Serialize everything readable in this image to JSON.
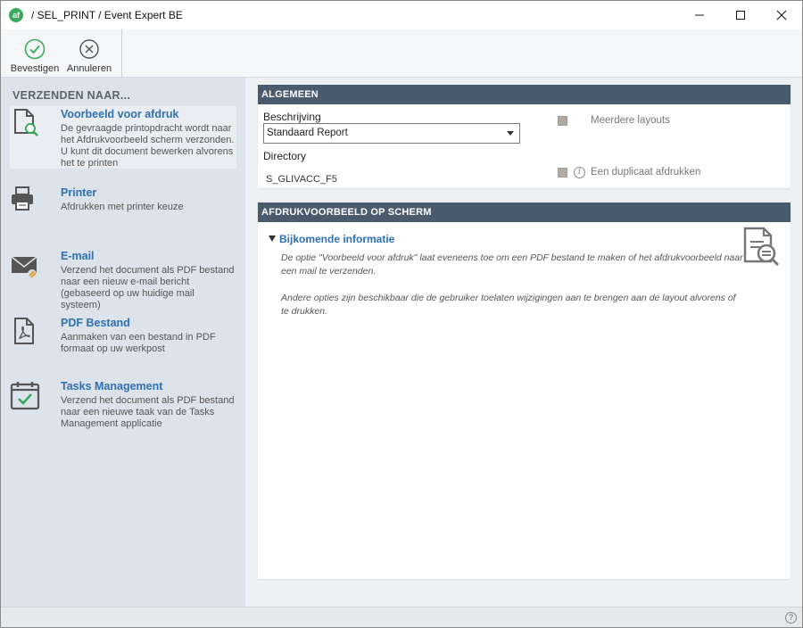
{
  "window": {
    "app_icon_text": "af",
    "title": "/ SEL_PRINT / Event Expert BE",
    "controls": [
      "minimize-icon",
      "maximize-icon",
      "close-icon"
    ]
  },
  "toolbar": {
    "confirm_label": "Bevestigen",
    "cancel_label": "Annuleren"
  },
  "sidebar": {
    "header": "VERZENDEN NAAR...",
    "items": [
      {
        "title": "Voorbeeld voor afdruk",
        "description": "De gevraagde printopdracht wordt naar het Afdrukvoorbeeld scherm verzonden. U kunt dit document bewerken alvorens het te printen",
        "icon": "print-preview-icon",
        "selected": true
      },
      {
        "title": "Printer",
        "description": "Afdrukken met printer keuze",
        "icon": "printer-icon",
        "selected": false
      },
      {
        "title": "E-mail",
        "description": "Verzend het document als PDF bestand naar een nieuw e-mail bericht (gebaseerd op uw huidige mail systeem)",
        "icon": "email-icon",
        "selected": false
      },
      {
        "title": "PDF Bestand",
        "description": "Aanmaken van een bestand in PDF formaat op uw werkpost",
        "icon": "pdf-file-icon",
        "selected": false
      },
      {
        "title": "Tasks Management",
        "description": "Verzend het document als PDF bestand naar een nieuwe taak van de Tasks Management applicatie",
        "icon": "calendar-check-icon",
        "selected": false
      }
    ]
  },
  "general": {
    "header": "ALGEMEEN",
    "description_label": "Beschrijving",
    "description_value": "Standaard Report",
    "directory_label": "Directory",
    "directory_value": "S_GLIVACC_F5",
    "multiple_layouts_label": "Meerdere layouts",
    "duplicate_label": "Een duplicaat afdrukken"
  },
  "preview": {
    "header": "AFDRUKVOORBEELD OP SCHERM",
    "accordion_title": "Bijkomende informatie",
    "paragraph1": "De optie \"Voorbeeld voor afdruk\" laat eveneens toe om een PDF bestand te maken of het afdrukvoorbeeld naar een mail te verzenden.",
    "paragraph2": "Andere opties zijn beschikbaar die de gebruiker toelaten wijzigingen aan te brengen aan de layout alvorens of te drukken."
  },
  "statusbar": {
    "help_text": "?"
  },
  "colors": {
    "section_header": "#4b5b6e",
    "link_blue": "#2f6fb3",
    "sidebar_bg": "#dce3ea",
    "accent_green": "#3aaa5c"
  }
}
